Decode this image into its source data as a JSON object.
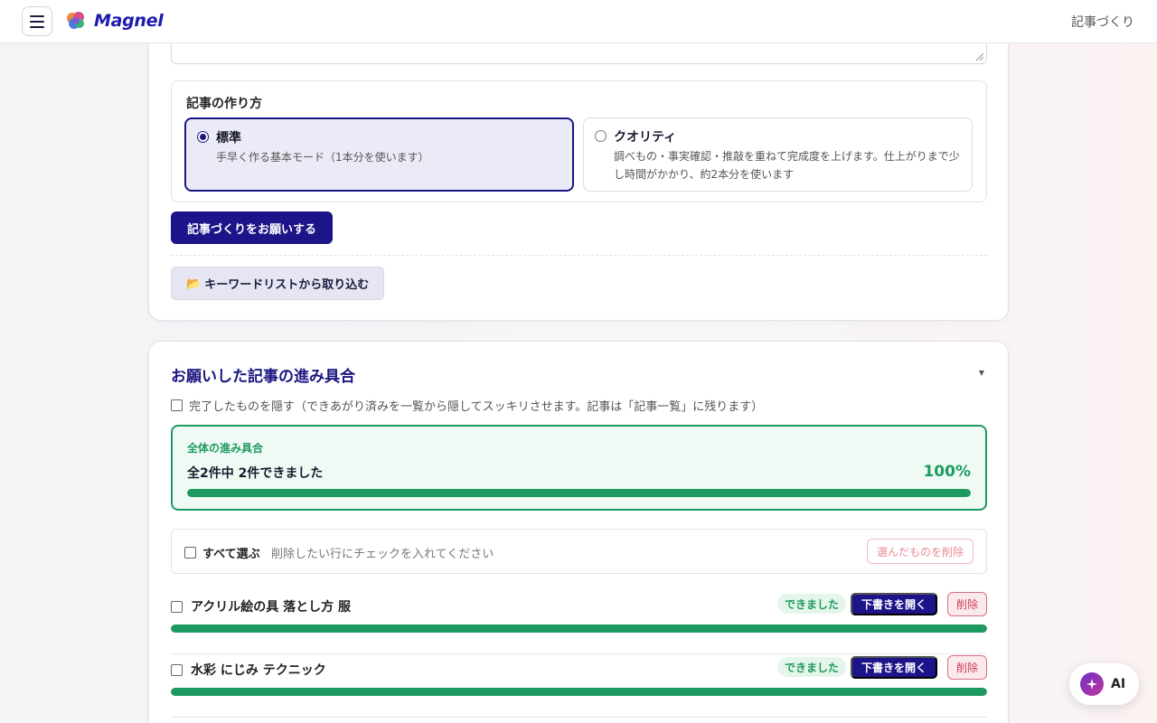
{
  "header": {
    "brand": "Magnel",
    "right_link": "記事づくり"
  },
  "form": {
    "method_title": "記事の作り方",
    "options": [
      {
        "title": "標準",
        "desc": "手早く作る基本モード（1本分を使います）",
        "selected": true
      },
      {
        "title": "クオリティ",
        "desc": "調べもの・事実確認・推敲を重ねて完成度を上げます。仕上がりまで少し時間がかかり、約2本分を使います",
        "selected": false
      }
    ],
    "submit_label": "記事づくりをお願いする",
    "import_icon": "📂",
    "import_label": "キーワードリストから取り込む"
  },
  "progress": {
    "title": "お願いした記事の進み具合",
    "collapse_icon": "▼",
    "hide_done_label": "完了したものを隠す（できあがり済みを一覧から隠してスッキリさせます。記事は「記事一覧」に残ります）",
    "overall_label": "全体の進み具合",
    "overall_count": "全2件中 2件できました",
    "overall_percent": "100%",
    "overall_fraction": 1.0,
    "select_all_label": "すべて選ぶ",
    "select_hint": "削除したい行にチェックを入れてください",
    "bulk_delete_label": "選んだものを削除",
    "items": [
      {
        "title": "アクリル絵の具 落とし方 服",
        "status": "できました",
        "open_label": "下書きを開く",
        "delete_label": "削除",
        "fraction": 1.0
      },
      {
        "title": "水彩 にじみ テクニック",
        "status": "できました",
        "open_label": "下書きを開く",
        "delete_label": "削除",
        "fraction": 1.0
      }
    ]
  },
  "ai_button": {
    "label": "AI",
    "icon": "sparkle-icon"
  },
  "colors": {
    "primary": "#1c1488",
    "success": "#1e9a60",
    "danger": "#c93e55"
  }
}
